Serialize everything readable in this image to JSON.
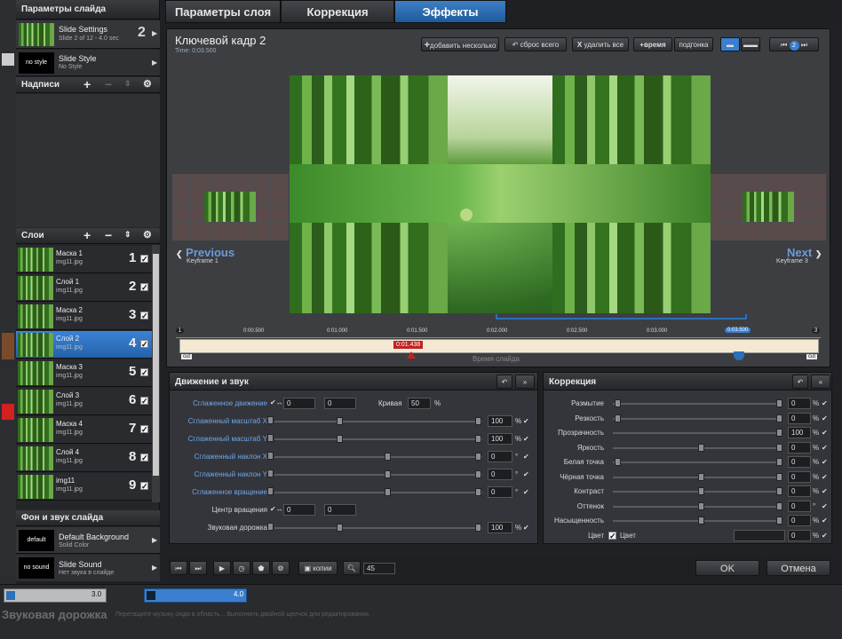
{
  "tabs": [
    "Параметры слоя",
    "Коррекция",
    "Эффекты"
  ],
  "left": {
    "slide_params": "Параметры слайда",
    "slide_settings": {
      "title": "Slide Settings",
      "sub": "Slide 2 of 12 - 4.0 sec",
      "num": "2"
    },
    "slide_style": {
      "thumb": "no style",
      "title": "Slide Style",
      "sub": "No Style"
    },
    "captions": "Надписи",
    "layers_header": "Слои",
    "layers": [
      {
        "name": "Маска 1",
        "file": "img11.jpg",
        "num": "1"
      },
      {
        "name": "Слой 1",
        "file": "img11.jpg",
        "num": "2"
      },
      {
        "name": "Маска 2",
        "file": "img11.jpg",
        "num": "3"
      },
      {
        "name": "Слой 2",
        "file": "img11.jpg",
        "num": "4"
      },
      {
        "name": "Маска 3",
        "file": "img11.jpg",
        "num": "5"
      },
      {
        "name": "Слой 3",
        "file": "img11.jpg",
        "num": "6"
      },
      {
        "name": "Маска 4",
        "file": "img11.jpg",
        "num": "7"
      },
      {
        "name": "Слой 4",
        "file": "img11.jpg",
        "num": "8"
      },
      {
        "name": "img11",
        "file": "img11.jpg",
        "num": "9"
      }
    ],
    "bg_sound": "Фон и звук слайда",
    "bg": {
      "thumb": "default",
      "title": "Default Background",
      "sub": "Solid Color"
    },
    "sound": {
      "thumb": "no sound",
      "title": "Slide Sound",
      "sub": "Нет звука в слайде"
    }
  },
  "keyframe": {
    "title": "Ключевой кадр 2",
    "time": "Time: 0:03.500"
  },
  "toolbar": {
    "add": "добавить",
    "several": "несколько",
    "reset": "сброс всего",
    "delete": "удалить все",
    "time": "время",
    "fit": "подгонка",
    "kf_num": "2"
  },
  "nav": {
    "prev": "Previous",
    "prev_sub": "Keyframe 1",
    "next": "Next",
    "next_sub": "Keyframe 3"
  },
  "timeline": {
    "ticks": [
      "0:00.500",
      "0:01.000",
      "0:01.500",
      "0:02.000",
      "0:02.500",
      "0:03.000",
      "0:03.500"
    ],
    "marker": "0:01.438",
    "label": "Время слайда",
    "cut": "cut",
    "kf1": "1",
    "kf3": "3"
  },
  "motion": {
    "title": "Движение и звук",
    "rows": [
      {
        "label": "Сглаженное движение",
        "v1": "0",
        "v2": "0",
        "extra": "Кривая",
        "extra_val": "50",
        "unit": "%"
      },
      {
        "label": "Сглаженный масштаб X",
        "value": "100",
        "unit": "%"
      },
      {
        "label": "Сглаженный масштаб Y",
        "value": "100",
        "unit": "%"
      },
      {
        "label": "Сглаженный наклон X",
        "value": "0",
        "unit": "°"
      },
      {
        "label": "Сглаженный наклон Y",
        "value": "0",
        "unit": "°"
      },
      {
        "label": "Сглаженное вращение",
        "value": "0",
        "unit": "°"
      },
      {
        "label": "Центр вращения",
        "v1": "0",
        "v2": "0"
      },
      {
        "label": "Звуковая дорожка",
        "value": "100",
        "unit": "%"
      }
    ]
  },
  "correction": {
    "title": "Коррекция",
    "rows": [
      {
        "label": "Размытие",
        "value": "0",
        "unit": "%"
      },
      {
        "label": "Резкость",
        "value": "0",
        "unit": "%"
      },
      {
        "label": "Прозрачность",
        "value": "100",
        "unit": "%"
      },
      {
        "label": "Яркость",
        "value": "0",
        "unit": "%"
      },
      {
        "label": "Белая точка",
        "value": "0",
        "unit": "%"
      },
      {
        "label": "Чёрная точка",
        "value": "0",
        "unit": "%"
      },
      {
        "label": "Контраст",
        "value": "0",
        "unit": "%"
      },
      {
        "label": "Оттенок",
        "value": "0",
        "unit": "°"
      },
      {
        "label": "Насыщенность",
        "value": "0",
        "unit": "%"
      },
      {
        "label": "Цвет",
        "checkbox": "Цвет",
        "value": "0",
        "unit": "%"
      }
    ]
  },
  "bottom": {
    "copy": "копии",
    "zoom": "45",
    "ok": "OK",
    "cancel": "Отмена"
  },
  "track": {
    "a": "3.0",
    "b": "4.0",
    "label": "Звуковая дорожка",
    "hint": "Перетащите музыку сюда в область... Выполнить двойной щелчок для редактирования."
  }
}
